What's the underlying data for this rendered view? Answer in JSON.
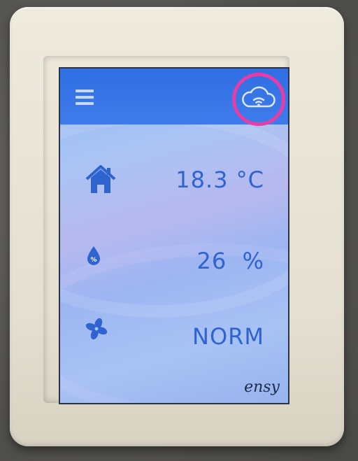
{
  "header": {
    "menu_icon": "hamburger-menu-icon",
    "connectivity_icon": "cloud-wifi-icon",
    "highlight_color": "#e63da6"
  },
  "readings": [
    {
      "icon": "house-icon",
      "value": "18.3 °C"
    },
    {
      "icon": "humidity-drop-icon",
      "value": "26  %"
    },
    {
      "icon": "fan-icon",
      "value": "NORM"
    }
  ],
  "brand": {
    "logo_text": "ensy"
  },
  "colors": {
    "topbar": "#2f6fe4",
    "value_text": "#2f63cf",
    "icon": "#2f63cf"
  }
}
